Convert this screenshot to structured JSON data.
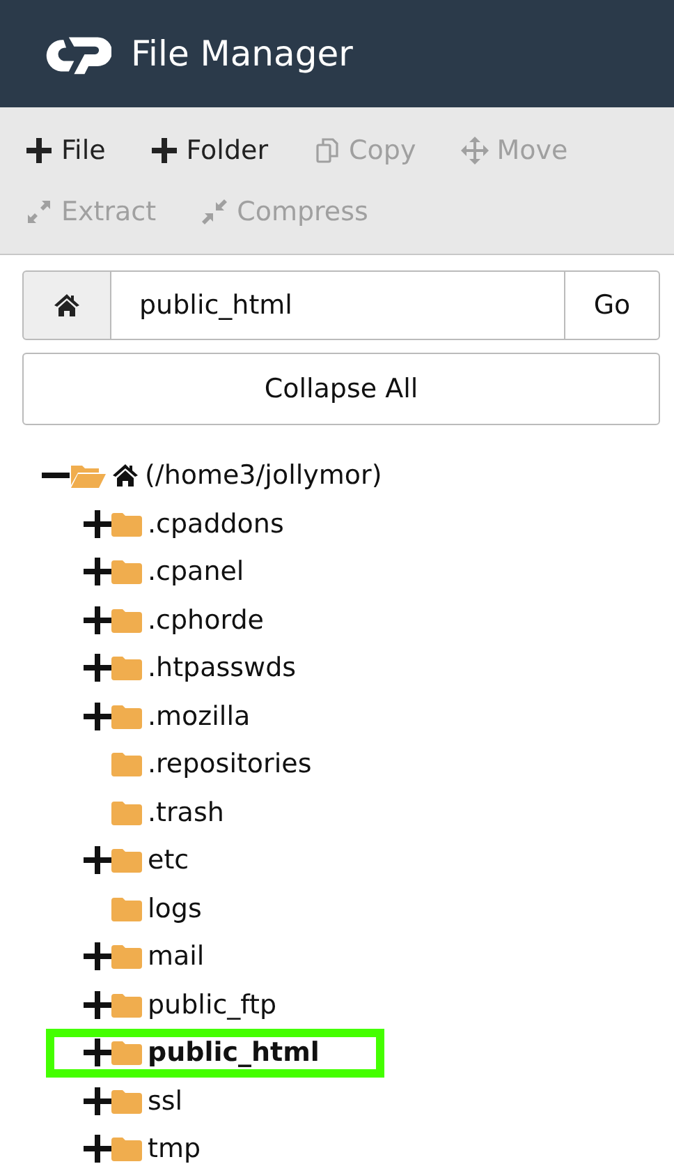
{
  "header": {
    "title": "File Manager"
  },
  "toolbar": [
    {
      "label": "File",
      "kind": "add",
      "disabled": false
    },
    {
      "label": "Folder",
      "kind": "add",
      "disabled": false
    },
    {
      "label": "Copy",
      "kind": "copy",
      "disabled": true
    },
    {
      "label": "Move",
      "kind": "move",
      "disabled": true
    },
    {
      "label": "Extract",
      "kind": "extract",
      "disabled": true
    },
    {
      "label": "Compress",
      "kind": "compress",
      "disabled": true
    }
  ],
  "path_bar": {
    "value": "public_html",
    "button": "Go"
  },
  "collapse_button": "Collapse All",
  "tree": {
    "label": "(/home3/jollymor)",
    "expanded": true,
    "children": [
      {
        "label": ".cpaddons",
        "expandable": true,
        "selected": false
      },
      {
        "label": ".cpanel",
        "expandable": true,
        "selected": false
      },
      {
        "label": ".cphorde",
        "expandable": true,
        "selected": false
      },
      {
        "label": ".htpasswds",
        "expandable": true,
        "selected": false
      },
      {
        "label": ".mozilla",
        "expandable": true,
        "selected": false
      },
      {
        "label": ".repositories",
        "expandable": false,
        "selected": false
      },
      {
        "label": ".trash",
        "expandable": false,
        "selected": false
      },
      {
        "label": "etc",
        "expandable": true,
        "selected": false
      },
      {
        "label": "logs",
        "expandable": false,
        "selected": false
      },
      {
        "label": "mail",
        "expandable": true,
        "selected": false
      },
      {
        "label": "public_ftp",
        "expandable": true,
        "selected": false
      },
      {
        "label": "public_html",
        "expandable": true,
        "selected": true
      },
      {
        "label": "ssl",
        "expandable": true,
        "selected": false
      },
      {
        "label": "tmp",
        "expandable": true,
        "selected": false
      }
    ]
  }
}
